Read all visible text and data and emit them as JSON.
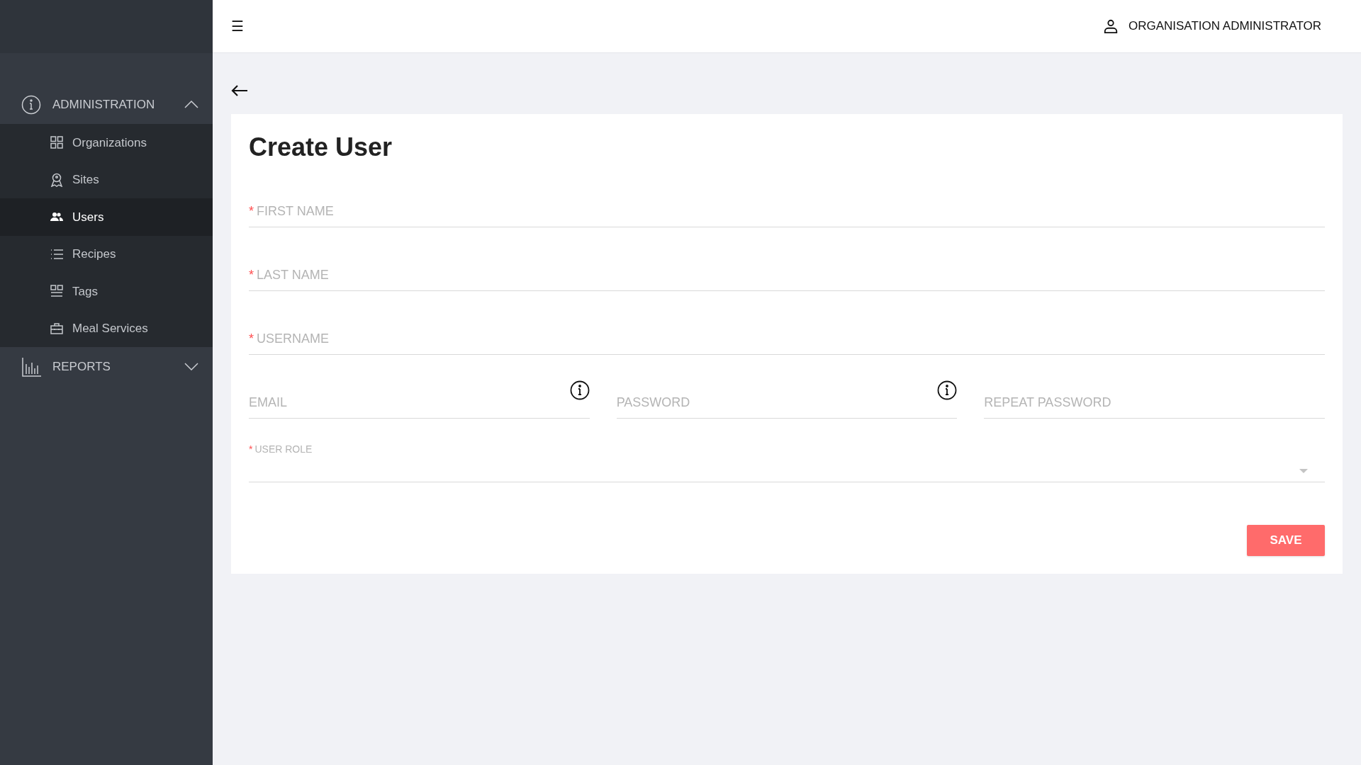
{
  "header": {
    "menu_glyph": "☰",
    "user": "ORGANISATION ADMINISTRATOR"
  },
  "sidebar": {
    "sections": [
      {
        "label": "ADMINISTRATION",
        "expanded": true,
        "children": [
          {
            "label": "Organizations",
            "selected": false
          },
          {
            "label": "Sites",
            "selected": false
          },
          {
            "label": "Users",
            "selected": true
          },
          {
            "label": "Recipes",
            "selected": false
          },
          {
            "label": "Tags",
            "selected": false
          },
          {
            "label": "Meal Services",
            "selected": false
          }
        ]
      },
      {
        "label": "REPORTS",
        "expanded": false
      }
    ]
  },
  "form": {
    "title": "Create User",
    "rows": [
      [
        {
          "kind": "text",
          "required_mark": "*",
          "placeholder": "FIRST NAME",
          "info": false
        }
      ],
      [
        {
          "kind": "text",
          "required_mark": "*",
          "placeholder": "LAST NAME",
          "info": false
        }
      ],
      [
        {
          "kind": "text",
          "required_mark": "*",
          "placeholder": "USERNAME",
          "info": false
        }
      ],
      [
        {
          "kind": "text",
          "placeholder": "EMAIL",
          "info": true
        },
        {
          "kind": "text",
          "placeholder": "PASSWORD",
          "info": true
        },
        {
          "kind": "text",
          "placeholder": "REPEAT PASSWORD",
          "info": false
        }
      ],
      [
        {
          "kind": "select",
          "required_mark": "*",
          "label": "USER ROLE"
        }
      ]
    ],
    "save": "SAVE"
  }
}
